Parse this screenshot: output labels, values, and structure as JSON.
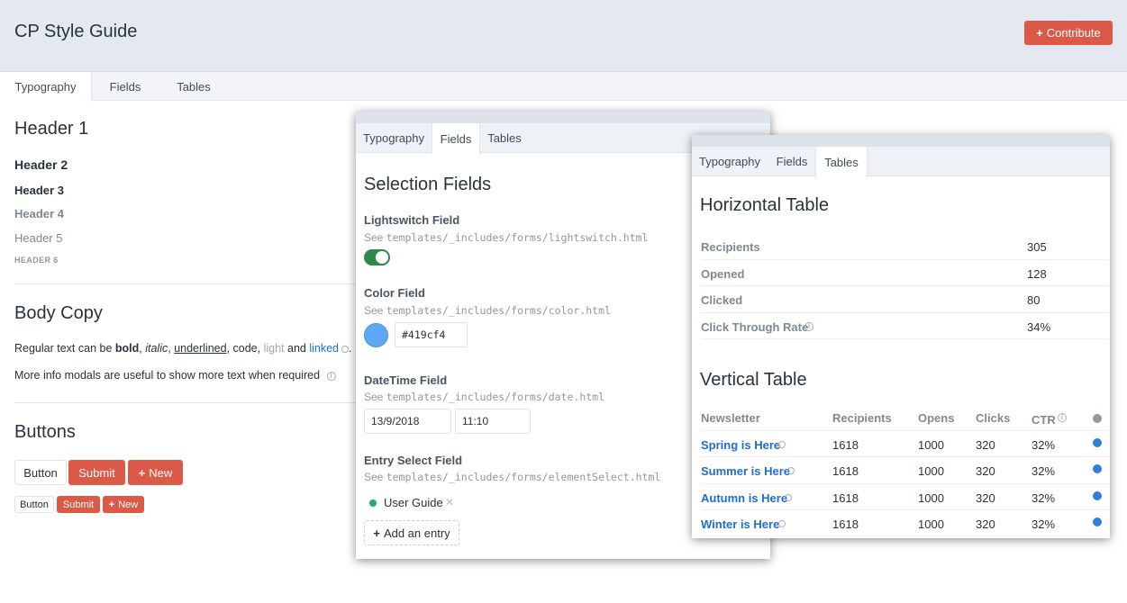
{
  "app": {
    "title": "CP Style Guide",
    "contribute_label": "Contribute"
  },
  "main_tabs": [
    "Typography",
    "Fields",
    "Tables"
  ],
  "typography": {
    "h1": "Header 1",
    "h2": "Header 2",
    "h3": "Header 3",
    "h4": "Header 4",
    "h5": "Header 5",
    "h6": "HEADER 6",
    "body_heading": "Body Copy",
    "body_parts": {
      "p1": "Regular text can be ",
      "bold": "bold",
      "c1": ", ",
      "italic": "italic",
      "c2": ", ",
      "underlined": "underlined",
      "c3": ", ",
      "code": "code",
      "c4": ", ",
      "light": "light",
      "and": " and ",
      "linked": "linked",
      "end": "."
    },
    "info_text": "More info modals are useful to show more text when required",
    "buttons_heading": "Buttons",
    "buttons": {
      "button": "Button",
      "submit": "Submit",
      "new": "New"
    }
  },
  "fields_panel": {
    "tabs": [
      "Typography",
      "Fields",
      "Tables"
    ],
    "heading": "Selection Fields",
    "lightswitch": {
      "label": "Lightswitch Field",
      "see": "See ",
      "path": "templates/_includes/forms/lightswitch.html",
      "on": true
    },
    "color": {
      "label": "Color Field",
      "see": "See ",
      "path": "templates/_includes/forms/color.html",
      "value": "#419cf4",
      "swatch": "#5ea8f5"
    },
    "datetime": {
      "label": "DateTime Field",
      "see": "See ",
      "path": "templates/_includes/forms/date.html",
      "date": "13/9/2018",
      "time": "11:10"
    },
    "entry": {
      "label": "Entry Select Field",
      "see": "See ",
      "path": "templates/_includes/forms/elementSelect.html",
      "selected": "User Guide",
      "add_label": "Add an entry"
    }
  },
  "tables_panel": {
    "tabs": [
      "Typography",
      "Fields",
      "Tables"
    ],
    "horizontal_heading": "Horizontal Table",
    "horizontal_rows": [
      {
        "label": "Recipients",
        "value": "305"
      },
      {
        "label": "Opened",
        "value": "128"
      },
      {
        "label": "Clicked",
        "value": "80"
      },
      {
        "label": "Click Through Rate",
        "value": "34%"
      }
    ],
    "vertical_heading": "Vertical Table",
    "vertical_columns": [
      "Newsletter",
      "Recipients",
      "Opens",
      "Clicks",
      "CTR"
    ],
    "vertical_rows": [
      {
        "newsletter": "Spring is Here",
        "recipients": "1618",
        "opens": "1000",
        "clicks": "320",
        "ctr": "32%"
      },
      {
        "newsletter": "Summer is Here",
        "recipients": "1618",
        "opens": "1000",
        "clicks": "320",
        "ctr": "32%"
      },
      {
        "newsletter": "Autumn is Here",
        "recipients": "1618",
        "opens": "1000",
        "clicks": "320",
        "ctr": "32%"
      },
      {
        "newsletter": "Winter is Here",
        "recipients": "1618",
        "opens": "1000",
        "clicks": "320",
        "ctr": "32%"
      }
    ]
  },
  "colors": {
    "accent_red": "#da5a47",
    "link_blue": "#1e6ed0",
    "switch_green": "#2e8a4a",
    "header_bg": "#e4e9f1"
  }
}
